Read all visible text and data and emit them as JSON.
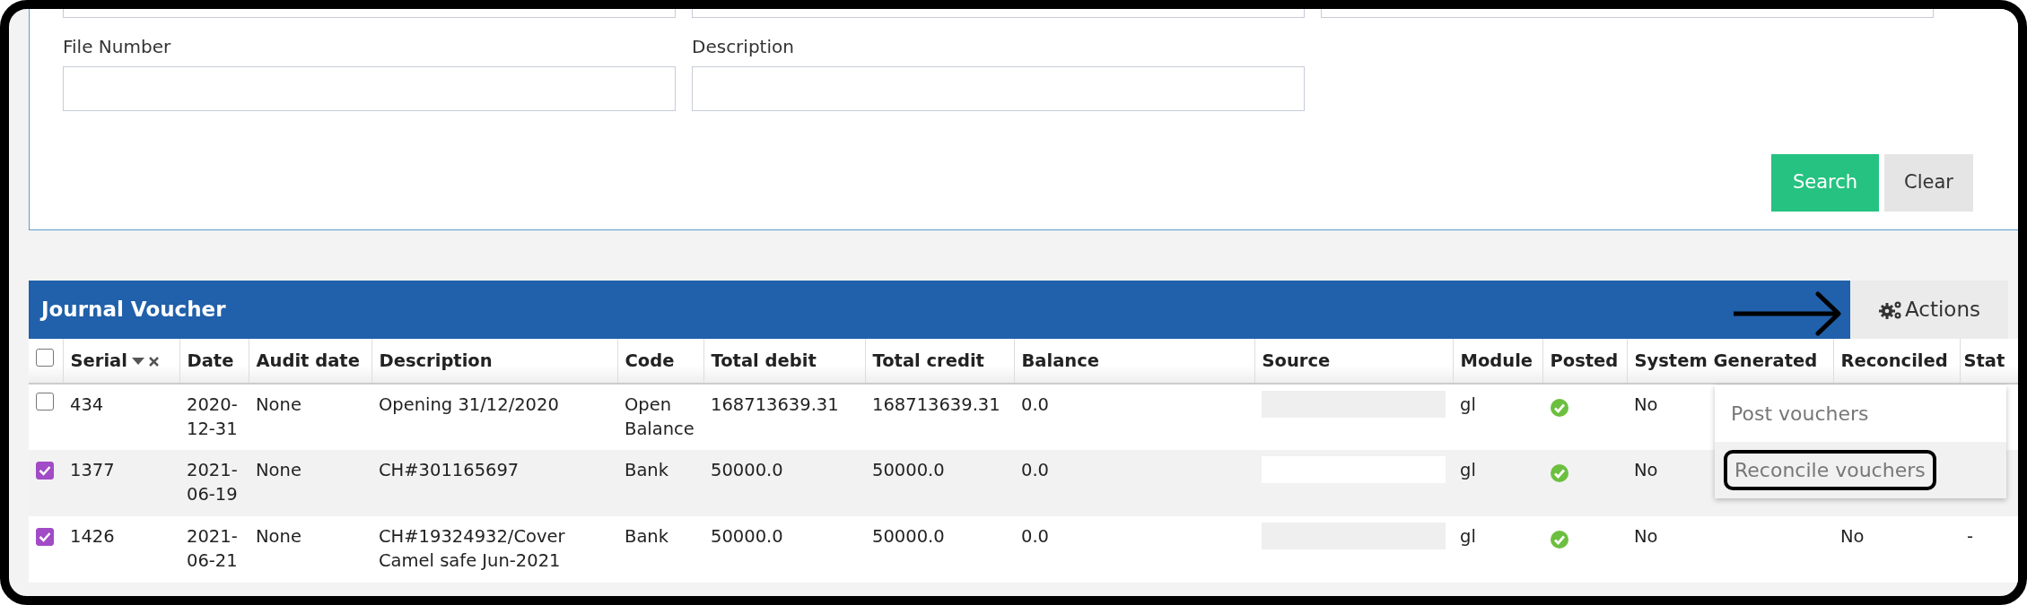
{
  "search_form": {
    "fields": [
      {
        "label": "File Number"
      },
      {
        "label": "Description"
      }
    ],
    "buttons": [
      {
        "label": "Search",
        "kind": "primary"
      },
      {
        "label": "Clear",
        "kind": "secondary"
      }
    ]
  },
  "journal_voucher": {
    "title": "Journal Voucher",
    "actions_button": "Actions",
    "actions_menu": [
      {
        "label": "Post vouchers",
        "selected": false
      },
      {
        "label": "Reconcile vouchers",
        "selected": true
      }
    ],
    "select_all_checked": false,
    "columns": [
      {
        "label": "Serial",
        "sorted": true
      },
      {
        "label": "Date",
        "sorted": false
      },
      {
        "label": "Audit date",
        "sorted": false
      },
      {
        "label": "Description",
        "sorted": false
      },
      {
        "label": "Code",
        "sorted": false
      },
      {
        "label": "Total debit",
        "sorted": false
      },
      {
        "label": "Total credit",
        "sorted": false
      },
      {
        "label": "Balance",
        "sorted": false
      },
      {
        "label": "Source",
        "sorted": false
      },
      {
        "label": "Module",
        "sorted": false
      },
      {
        "label": "Posted",
        "sorted": false
      },
      {
        "label": "System Generated",
        "sorted": false
      },
      {
        "label": "Reconciled",
        "sorted": false
      },
      {
        "label": "Stat",
        "sorted": false
      }
    ],
    "rows": [
      {
        "checked": false,
        "serial": "434",
        "date": "2020-12-31",
        "audit_date": "None",
        "description": "Opening 31/12/2020",
        "code": "Open Balance",
        "total_debit": "168713639.31",
        "total_credit": "168713639.31",
        "balance": "0.0",
        "module": "gl",
        "posted": true,
        "system_generated": "No"
      },
      {
        "checked": true,
        "serial": "1377",
        "date": "2021-06-19",
        "audit_date": "None",
        "description": "CH#301165697",
        "code": "Bank",
        "total_debit": "50000.0",
        "total_credit": "50000.0",
        "balance": "0.0",
        "module": "gl",
        "posted": true,
        "system_generated": "No"
      },
      {
        "checked": true,
        "serial": "1426",
        "date": "2021-06-21",
        "audit_date": "None",
        "description": "CH#19324932/Cover Camel safe Jun-2021",
        "code": "Bank",
        "total_debit": "50000.0",
        "total_credit": "50000.0",
        "balance": "0.0",
        "module": "gl",
        "posted": true,
        "system_generated": "No",
        "reconciled": "No",
        "status": "-"
      }
    ]
  }
}
